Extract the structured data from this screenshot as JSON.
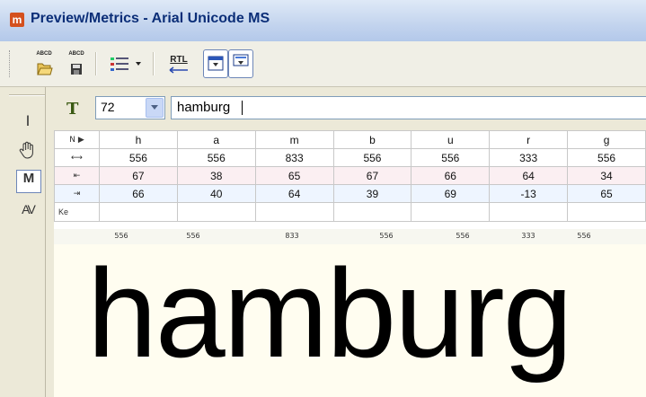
{
  "window": {
    "title": "Preview/Metrics - Arial Unicode MS",
    "app_icon": "m"
  },
  "toolbar": {
    "open_label": "ABCD",
    "save_label": "ABCD",
    "rtl_label": "RTL"
  },
  "side_tools": [
    {
      "name": "text-cursor-tool",
      "glyph": "I"
    },
    {
      "name": "hand-tool",
      "glyph": "☝"
    },
    {
      "name": "metrics-tool",
      "glyph": "M"
    },
    {
      "name": "kerning-tool",
      "glyph": "AV"
    }
  ],
  "size_field": {
    "value": "72"
  },
  "text_field": {
    "value": "hamburg"
  },
  "metrics": {
    "header_label": "N ▶",
    "glyphs": [
      "h",
      "a",
      "m",
      "b",
      "u",
      "r",
      "g"
    ],
    "advance_icon": "⟷",
    "advance": [
      "556",
      "556",
      "833",
      "556",
      "556",
      "333",
      "556"
    ],
    "lsb_icon": "⇤",
    "lsb": [
      "67",
      "38",
      "65",
      "67",
      "66",
      "64",
      "34"
    ],
    "rsb_icon": "⇥",
    "rsb": [
      "66",
      "40",
      "64",
      "39",
      "69",
      "-13",
      "65"
    ],
    "kern_label": "Ke"
  },
  "ruler": {
    "values": [
      "556",
      "556",
      "833",
      "556",
      "556",
      "333",
      "556"
    ]
  },
  "preview": {
    "text": "hamburg"
  },
  "colors": {
    "title_text": "#0b2e78",
    "accent_border": "#6d86b8",
    "preview_bg": "#fffdf0"
  }
}
